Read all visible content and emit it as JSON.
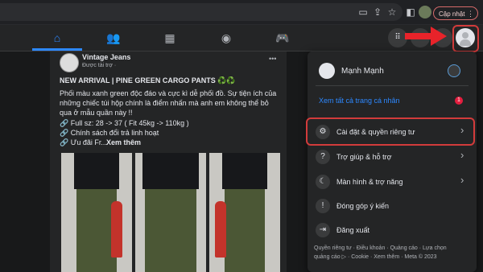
{
  "browser": {
    "update_label": "Cập nhật",
    "icons": [
      "cast-icon",
      "share-icon",
      "star-icon",
      "sidebar-icon",
      "profile-icon",
      "menu-dots-icon"
    ]
  },
  "fb_nav": {
    "tabs": [
      "home-icon",
      "friends-icon",
      "marketplace-icon",
      "groups-icon",
      "gaming-icon"
    ],
    "active_color": "#2d88ff"
  },
  "post": {
    "page_name": "Vintage Jeans",
    "sponsored": "Được tài trợ · ",
    "more": "•••",
    "headline": "NEW ARRIVAL | PINE GREEN CARGO PANTS ♻️♻️",
    "body_lines": [
      "Phối màu xanh green độc đáo và cực kì dễ phối đồ. Sự tiện ích của",
      "những chiếc túi hộp chính là điểm nhấn mà anh em không thể bỏ",
      "qua ở mẫu quần này !!"
    ],
    "bullets": [
      "🔗 Full sz: 28 -> 37 ( Fit 45kg -> 110kg )",
      "🔗 Chính sách đổi trả linh hoạt",
      "🔗 Ưu đãi Fr..."
    ],
    "see_more": "Xem thêm"
  },
  "menu": {
    "user_name": "Mạnh Mạnh",
    "see_all_profiles": "Xem tất cả trang cá nhân",
    "badge": "1",
    "items": [
      {
        "label": "Cài đặt & quyền riêng tư",
        "icon": "gear-icon",
        "chevron": true
      },
      {
        "label": "Trợ giúp & hỗ trợ",
        "icon": "help-icon",
        "chevron": true
      },
      {
        "label": "Màn hình & trợ năng",
        "icon": "moon-icon",
        "chevron": true
      },
      {
        "label": "Đóng góp ý kiến",
        "icon": "feedback-icon",
        "chevron": false
      },
      {
        "label": "Đăng xuất",
        "icon": "logout-icon",
        "chevron": false
      }
    ],
    "footer_line1": "Quyền riêng tư · Điều khoản · Quảng cáo · Lựa chọn",
    "footer_line2": "quảng cáo ▷ · Cookie · Xem thêm · Meta © 2023"
  },
  "colors": {
    "highlight": "#d23b3b",
    "link": "#2d88ff"
  }
}
